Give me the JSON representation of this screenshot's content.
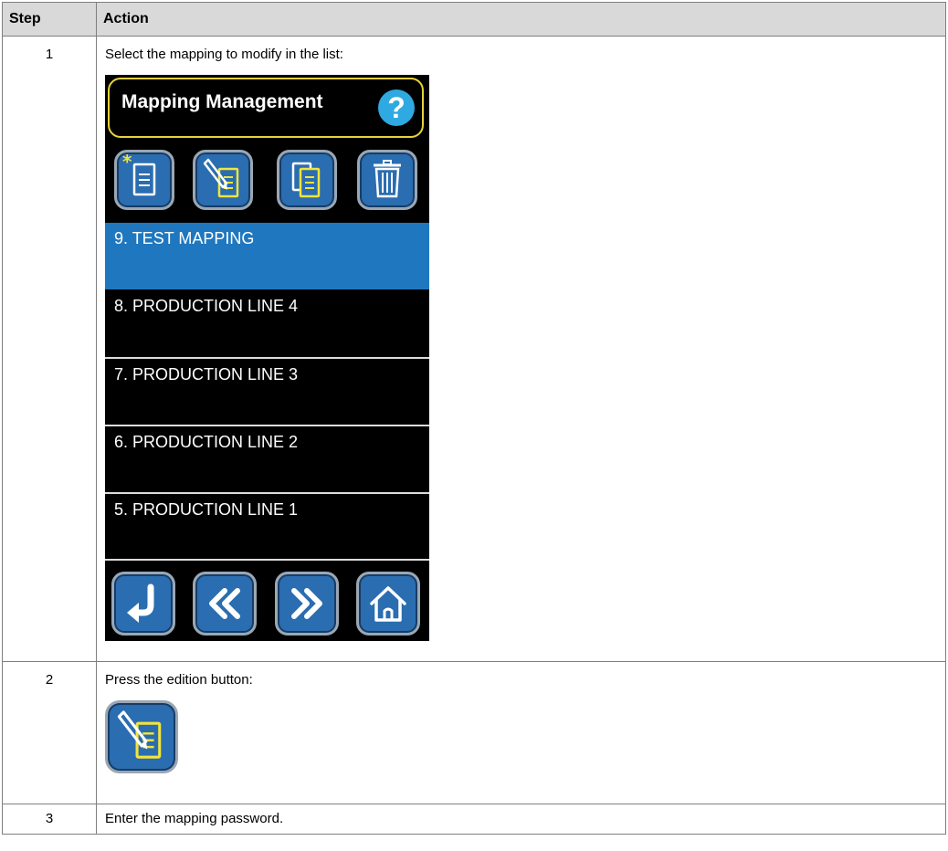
{
  "table": {
    "headers": [
      "Step",
      "Action"
    ],
    "rows": [
      {
        "step": "1",
        "text": "Select the mapping to modify in the list:"
      },
      {
        "step": "2",
        "text": "Press the edition button:"
      },
      {
        "step": "3",
        "text": "Enter the mapping password."
      }
    ]
  },
  "device": {
    "title": "Mapping Management",
    "help_symbol": "?",
    "toolbar": [
      {
        "name": "new-mapping-icon"
      },
      {
        "name": "edit-mapping-icon"
      },
      {
        "name": "copy-mapping-icon"
      },
      {
        "name": "delete-mapping-icon"
      }
    ],
    "list": [
      {
        "label": "9.  TEST MAPPING",
        "selected": true
      },
      {
        "label": "8.  PRODUCTION LINE 4",
        "selected": false
      },
      {
        "label": "7.  PRODUCTION LINE 3",
        "selected": false
      },
      {
        "label": "6. PRODUCTION LINE 2",
        "selected": false
      },
      {
        "label": "5. PRODUCTION LINE 1",
        "selected": false
      }
    ],
    "nav": [
      {
        "name": "back-icon"
      },
      {
        "name": "page-previous-icon"
      },
      {
        "name": "page-next-icon"
      },
      {
        "name": "home-icon"
      }
    ]
  },
  "colors": {
    "button_blue": "#2a6db0",
    "selected_row": "#1f77bf",
    "title_border": "#e5d43a",
    "help_blue": "#2fa9e1"
  }
}
